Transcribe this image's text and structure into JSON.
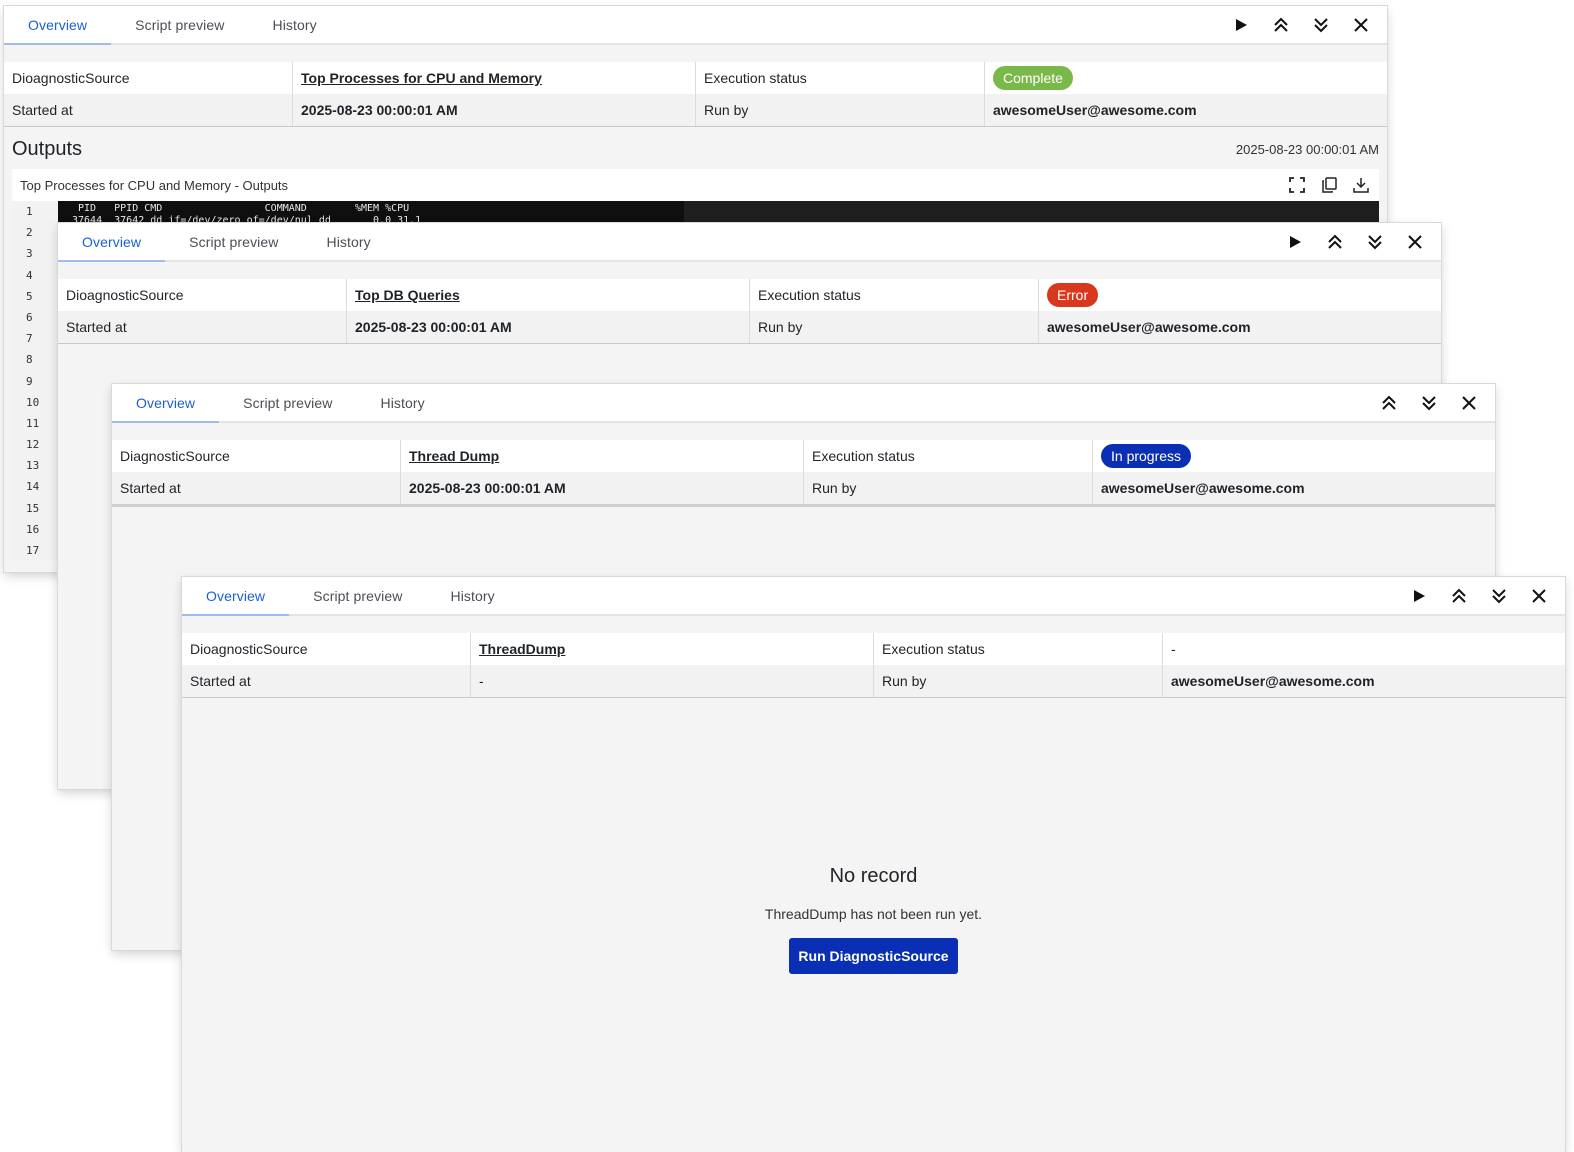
{
  "tabs": {
    "overview": "Overview",
    "script_preview": "Script preview",
    "history": "History"
  },
  "labels": {
    "execution_status": "Execution status",
    "started_at": "Started at",
    "run_by": "Run by"
  },
  "panel1": {
    "source_label": "DioagnosticSource",
    "source_link": "Top Processes for CPU and Memory",
    "status": "Complete",
    "status_color": "#7bb84a",
    "started_at": "2025-08-23 00:00:01 AM",
    "run_by": "awesomeUser@awesome.com",
    "outputs_title": "Outputs",
    "outputs_time": "2025-08-23 00:00:01 AM",
    "output_card_title": "Top Processes for CPU and Memory - Outputs",
    "terminal_line1": " PID   PPID CMD                 COMMAND        %MEM %CPU",
    "terminal_line2": "37644  37642 dd if=/dev/zero of=/dev/nul dd       0.0 31.1",
    "line_numbers": [
      "1",
      "2",
      "3",
      "4",
      "5",
      "6",
      "7",
      "8",
      "9",
      "10",
      "11",
      "12",
      "13",
      "14",
      "15",
      "16",
      "17"
    ]
  },
  "panel2": {
    "source_label": "DioagnosticSource",
    "source_link": "Top DB Queries",
    "status": "Error",
    "status_color": "#d9381e",
    "started_at": "2025-08-23 00:00:01 AM",
    "run_by": "awesomeUser@awesome.com"
  },
  "panel3": {
    "source_label": "DiagnosticSource",
    "source_link": "Thread Dump",
    "status": "In progress",
    "status_color": "#0a2fb5",
    "started_at": "2025-08-23 00:00:01 AM",
    "run_by": "awesomeUser@awesome.com"
  },
  "panel4": {
    "source_label": "DioagnosticSource",
    "source_link": "ThreadDump",
    "status": "-",
    "started_at": "-",
    "run_by": "awesomeUser@awesome.com",
    "empty_title": "No record",
    "empty_subtitle": "ThreadDump has not been run yet.",
    "run_button": "Run DiagnosticSource"
  },
  "icons": [
    "play-icon",
    "collapse-up-icon",
    "expand-down-icon",
    "close-icon",
    "fullscreen-icon",
    "copy-icon",
    "download-icon"
  ]
}
